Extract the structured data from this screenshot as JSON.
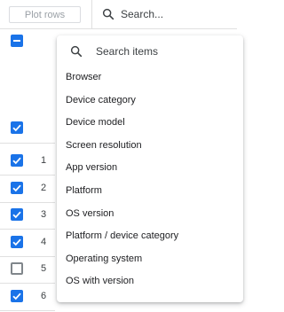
{
  "toolbar": {
    "plot_rows_label": "Plot rows",
    "search_placeholder": "Search..."
  },
  "table": {
    "rows": [
      {
        "number": "1",
        "checked": true
      },
      {
        "number": "2",
        "checked": true
      },
      {
        "number": "3",
        "checked": true
      },
      {
        "number": "4",
        "checked": true
      },
      {
        "number": "5",
        "checked": false
      },
      {
        "number": "6",
        "checked": true
      }
    ]
  },
  "dropdown": {
    "search_placeholder": "Search items",
    "items": [
      {
        "label": "Browser"
      },
      {
        "label": "Device category"
      },
      {
        "label": "Device model"
      },
      {
        "label": "Screen resolution"
      },
      {
        "label": "App version"
      },
      {
        "label": "Platform"
      },
      {
        "label": "OS version"
      },
      {
        "label": "Platform / device category"
      },
      {
        "label": "Operating system"
      },
      {
        "label": "OS with version"
      }
    ]
  },
  "colors": {
    "accent": "#1a73e8",
    "text": "#202124",
    "muted": "#9aa0a6",
    "border": "#dadce0"
  }
}
